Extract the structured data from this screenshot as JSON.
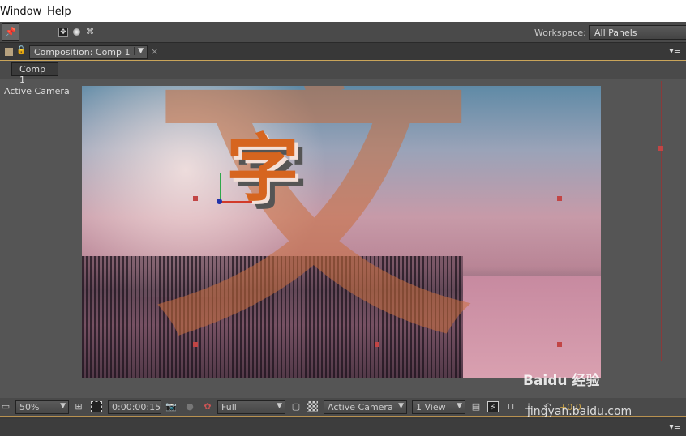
{
  "menu": {
    "items": [
      "Window",
      "Help"
    ]
  },
  "toolbar": {
    "workspace_label": "Workspace:",
    "workspace_value": "All Panels"
  },
  "panel": {
    "tab_label": "Composition: Comp 1",
    "breadcrumb": "Comp 1",
    "view_label": "Active Camera"
  },
  "composition": {
    "large_char": "文",
    "small_char": "字"
  },
  "viewer_controls": {
    "magnification": "50%",
    "timecode": "0:00:00:15",
    "resolution": "Full",
    "camera": "Active Camera",
    "views": "1 View",
    "exposure": "+0.0"
  },
  "watermark": {
    "brand": "Baidu 经验",
    "url": "jingyan.baidu.com"
  }
}
